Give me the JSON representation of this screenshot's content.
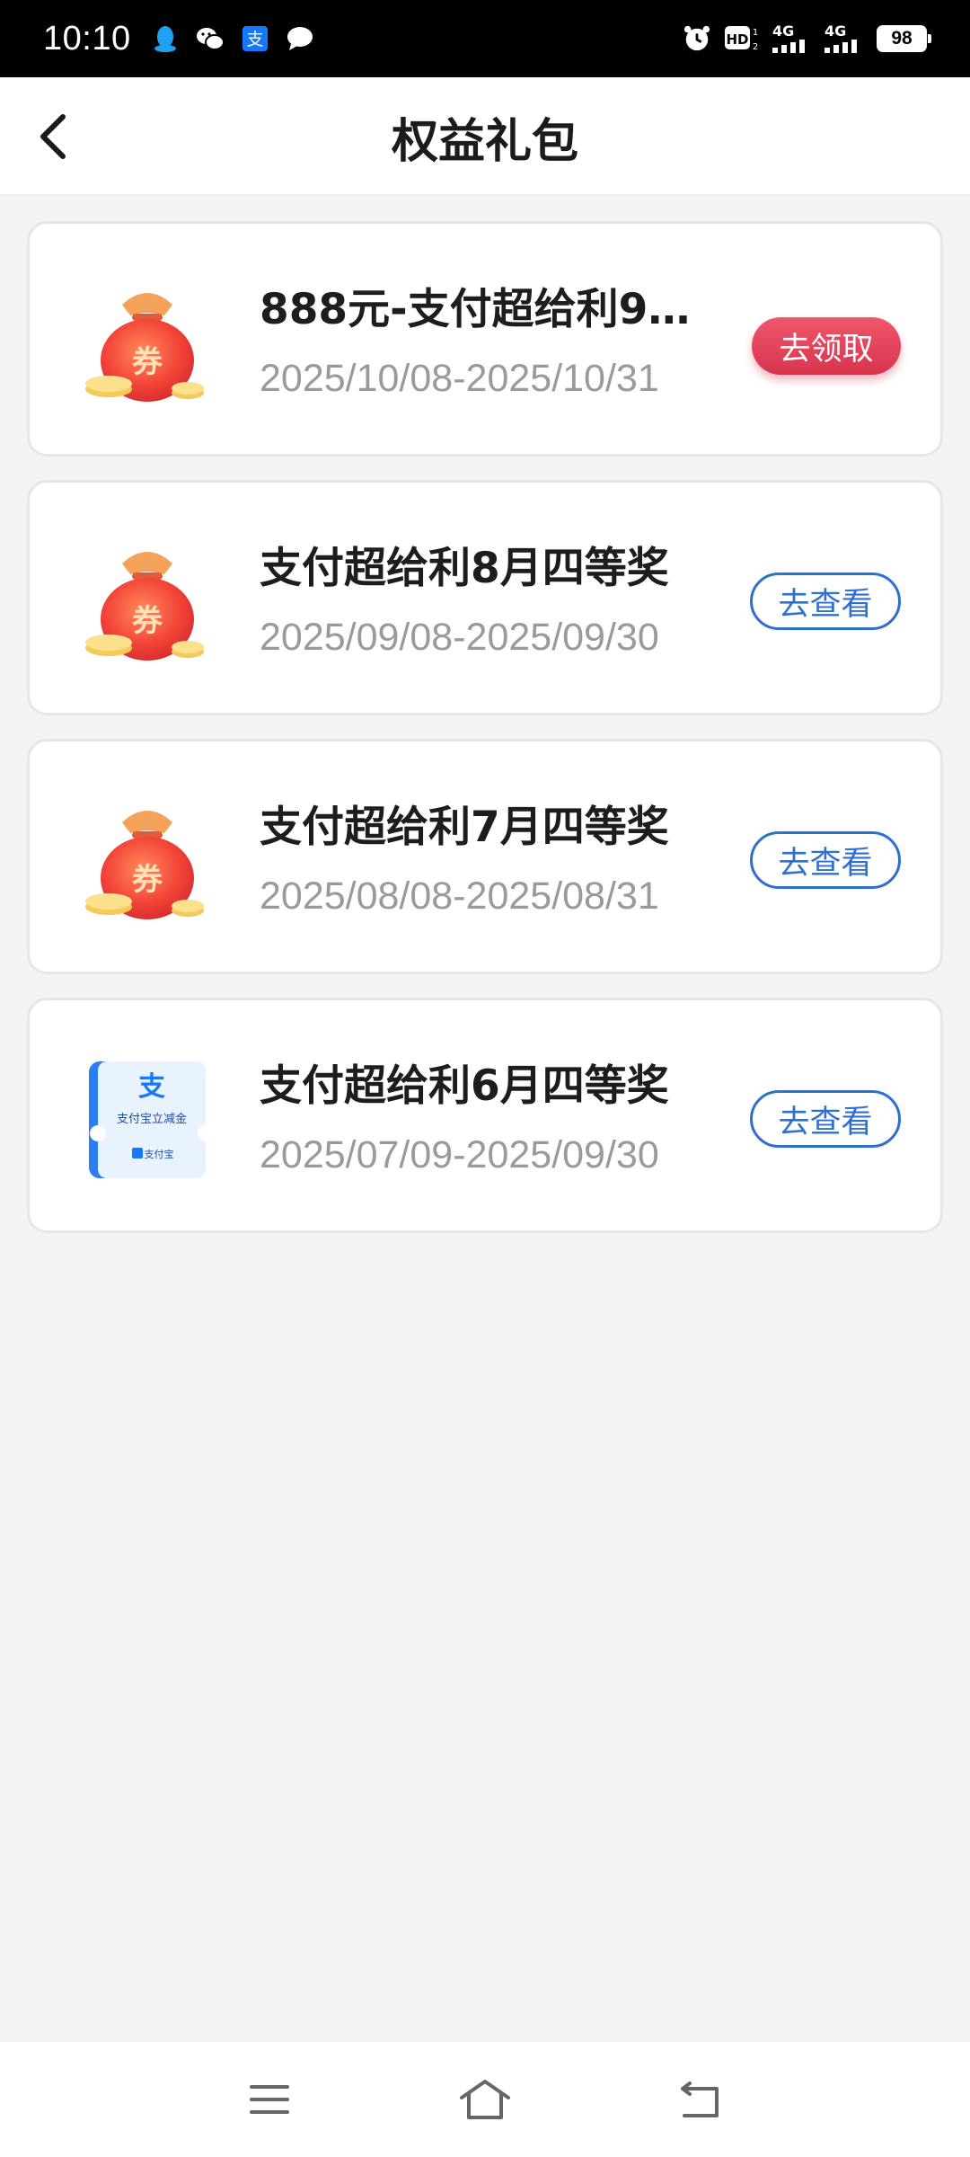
{
  "status_bar": {
    "time": "10:10",
    "left_icons": [
      "qq-icon",
      "wechat-icon",
      "alipay-icon",
      "message-icon"
    ],
    "network1": "4G",
    "network2": "4G",
    "hd_label": "HD",
    "battery": "98"
  },
  "header": {
    "title": "权益礼包",
    "back_icon": "chevron-left-icon"
  },
  "items": [
    {
      "title": "888元-支付超给利9…",
      "date": "2025/10/08-2025/10/31",
      "icon": "red-envelope-bag-icon",
      "icon_text": "券",
      "button": "去领取",
      "button_style": "primary"
    },
    {
      "title": "支付超给利8月四等奖",
      "date": "2025/09/08-2025/09/30",
      "icon": "red-envelope-bag-icon",
      "icon_text": "券",
      "button": "去查看",
      "button_style": "outline"
    },
    {
      "title": "支付超给利7月四等奖",
      "date": "2025/08/08-2025/08/31",
      "icon": "red-envelope-bag-icon",
      "icon_text": "券",
      "button": "去查看",
      "button_style": "outline"
    },
    {
      "title": "支付超给利6月四等奖",
      "date": "2025/07/09-2025/09/30",
      "icon": "alipay-coupon-icon",
      "icon_text": "支付宝立减金",
      "icon_logo": "支",
      "icon_brand": "支付宝",
      "button": "去查看",
      "button_style": "outline"
    }
  ],
  "nav_bar": {
    "items": [
      "menu-icon",
      "home-icon",
      "back-icon"
    ]
  },
  "colors": {
    "primary_red": "#e0445b",
    "link_blue": "#2f6fd0",
    "date_gray": "#9a9a9a",
    "background": "#f3f3f4"
  }
}
